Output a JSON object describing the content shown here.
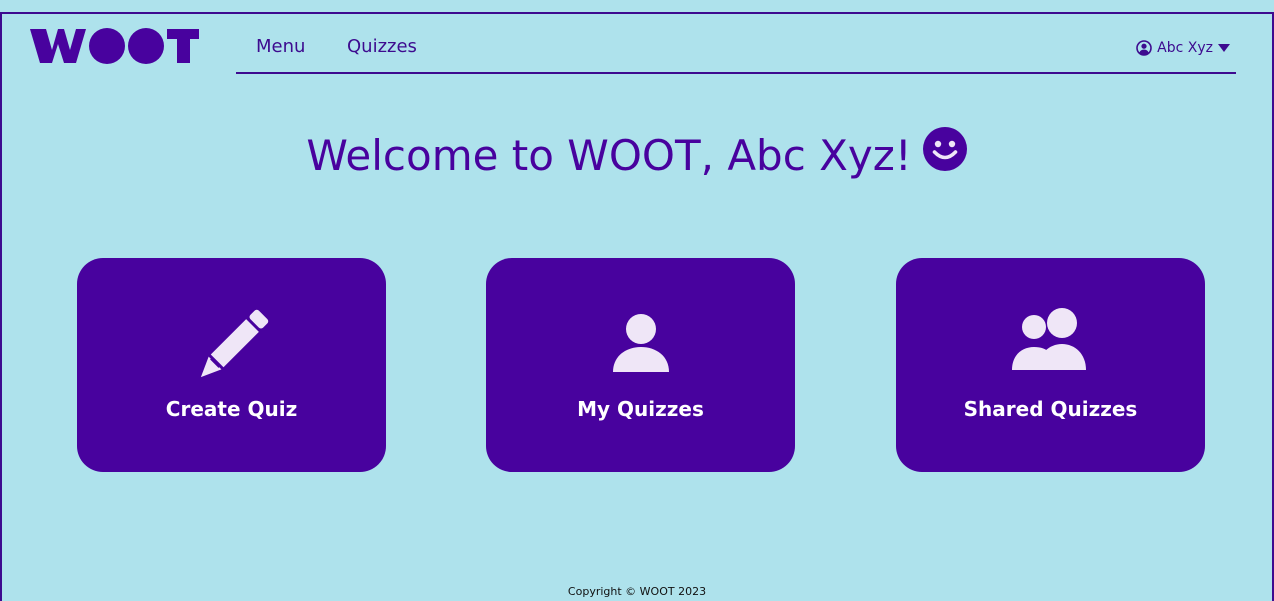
{
  "brand": {
    "logo_text": "WOOT"
  },
  "nav": {
    "items": [
      {
        "label": "Menu"
      },
      {
        "label": "Quizzes"
      }
    ]
  },
  "user": {
    "name": "Abc Xyz",
    "icon": "user-circle-icon",
    "dropdown_icon": "caret-down-icon"
  },
  "welcome": {
    "text": "Welcome to WOOT, Abc Xyz!",
    "icon": "smile-icon"
  },
  "cards": [
    {
      "label": "Create Quiz",
      "icon": "pencil-icon"
    },
    {
      "label": "My Quizzes",
      "icon": "user-icon"
    },
    {
      "label": "Shared Quizzes",
      "icon": "users-icon"
    }
  ],
  "footer": {
    "copyright": "Copyright © WOOT 2023"
  },
  "colors": {
    "background": "#aee2ec",
    "primary": "#48029e",
    "card_text": "#ffffff",
    "icon_fill": "#efe6f7"
  }
}
